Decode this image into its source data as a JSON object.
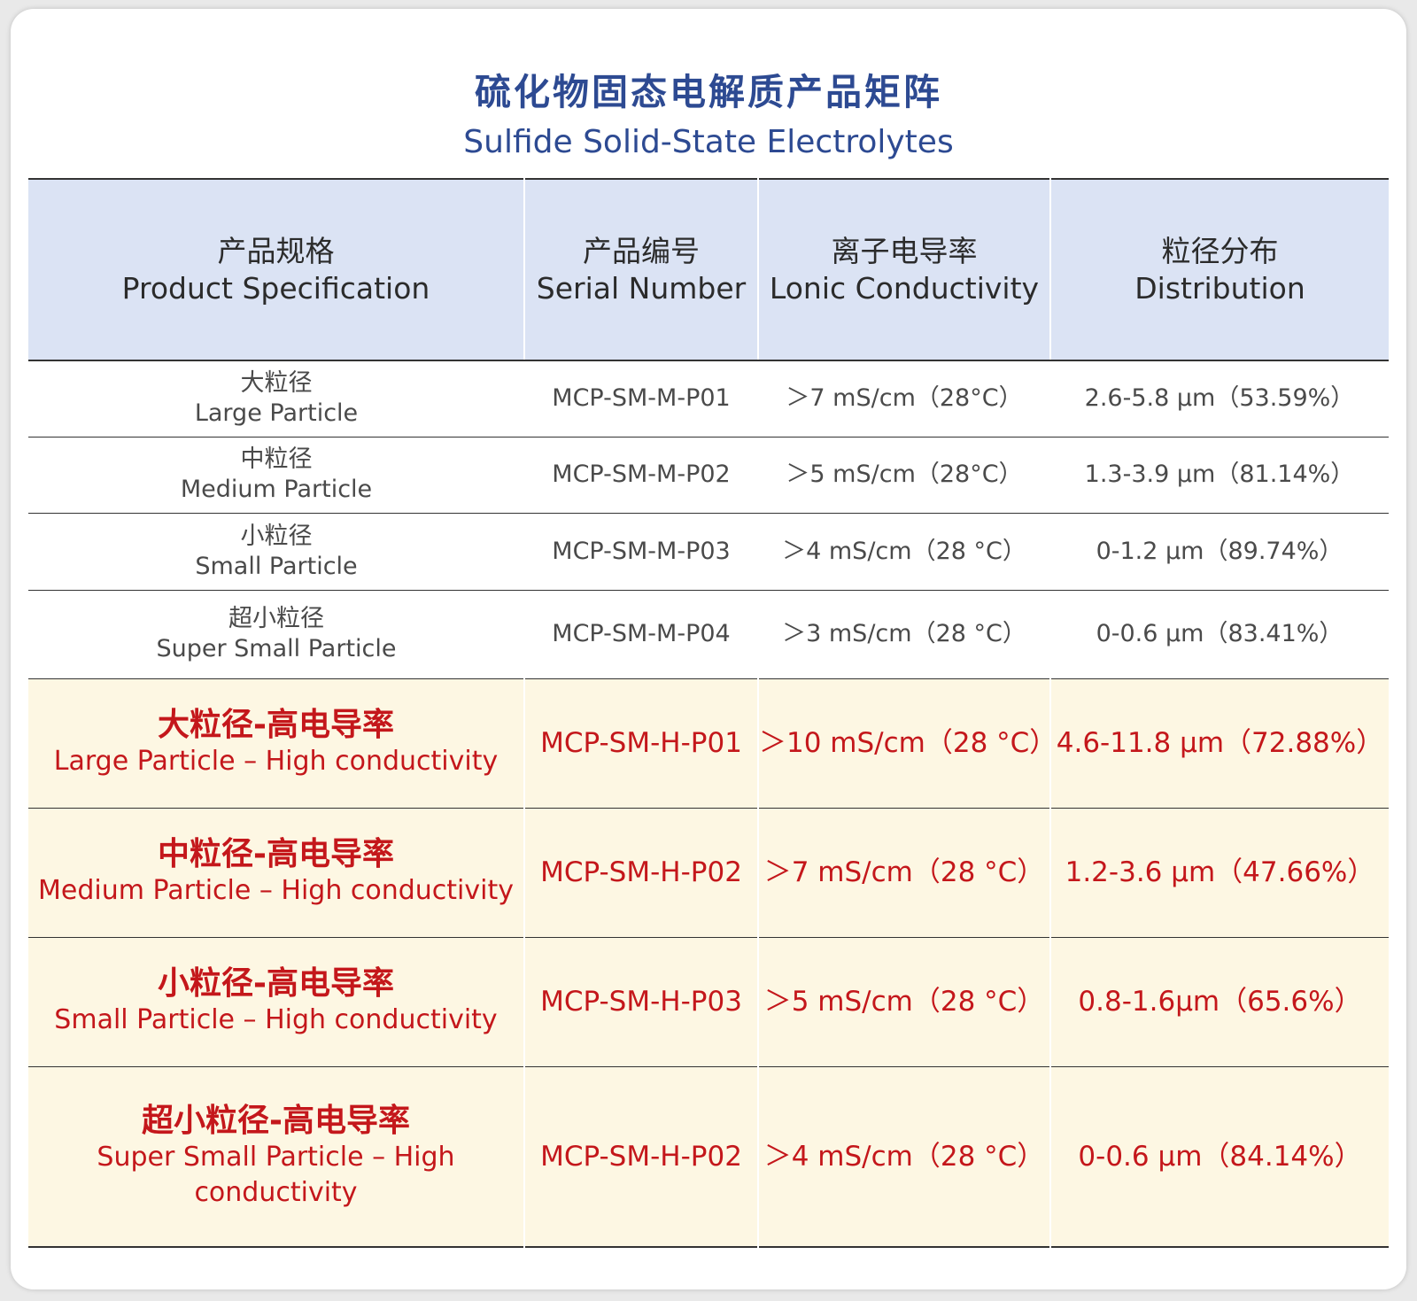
{
  "title_zh": "硫化物固态电解质产品矩阵",
  "title_en": "Sulfide Solid-State Electrolytes",
  "headers": [
    {
      "zh": "产品规格",
      "en": "Product Specification"
    },
    {
      "zh": "产品编号",
      "en": "Serial Number"
    },
    {
      "zh": "离子电导率",
      "en": "Lonic Conductivity"
    },
    {
      "zh": "粒径分布",
      "en": "Distribution"
    }
  ],
  "rows": [
    {
      "spec_zh": "大粒径",
      "spec_en": "Large Particle",
      "serial": "MCP-SM-M-P01",
      "conductivity": "＞7 mS/cm（28°C）",
      "distribution": "2.6-5.8 μm（53.59%）"
    },
    {
      "spec_zh": "中粒径",
      "spec_en": "Medium Particle",
      "serial": "MCP-SM-M-P02",
      "conductivity": "＞5 mS/cm（28°C）",
      "distribution": "1.3-3.9 μm（81.14%）"
    },
    {
      "spec_zh": "小粒径",
      "spec_en": "Small Particle",
      "serial": "MCP-SM-M-P03",
      "conductivity": "＞4 mS/cm（28 °C）",
      "distribution": "0-1.2 μm（89.74%）"
    },
    {
      "spec_zh": "超小粒径",
      "spec_en": "Super Small Particle",
      "serial": "MCP-SM-M-P04",
      "conductivity": "＞3 mS/cm（28 °C）",
      "distribution": "0-0.6 μm（83.41%）"
    },
    {
      "spec_zh": "大粒径-高电导率",
      "spec_en": "Large Particle – High conductivity",
      "serial": "MCP-SM-H-P01",
      "conductivity": "＞10 mS/cm（28 °C）",
      "distribution": "4.6-11.8 μm（72.88%）"
    },
    {
      "spec_zh": "中粒径-高电导率",
      "spec_en": "Medium Particle – High conductivity",
      "serial": "MCP-SM-H-P02",
      "conductivity": "＞7 mS/cm（28 °C）",
      "distribution": "1.2-3.6 μm（47.66%）"
    },
    {
      "spec_zh": "小粒径-高电导率",
      "spec_en": "Small Particle – High conductivity",
      "serial": "MCP-SM-H-P03",
      "conductivity": "＞5 mS/cm（28 °C）",
      "distribution": "0.8-1.6μm（65.6%）"
    },
    {
      "spec_zh": "超小粒径-高电导率",
      "spec_en": "Super Small Particle – High conductivity",
      "serial": "MCP-SM-H-P02",
      "conductivity": "＞4 mS/cm（28 °C）",
      "distribution": "0-0.6 μm（84.14%）"
    }
  ],
  "colors": {
    "title": "#2d4a92",
    "header_bg": "#dbe3f4",
    "highlight_bg": "#fdf7e3",
    "highlight_text": "#c4171b",
    "standard_text": "#4a4a4a"
  }
}
